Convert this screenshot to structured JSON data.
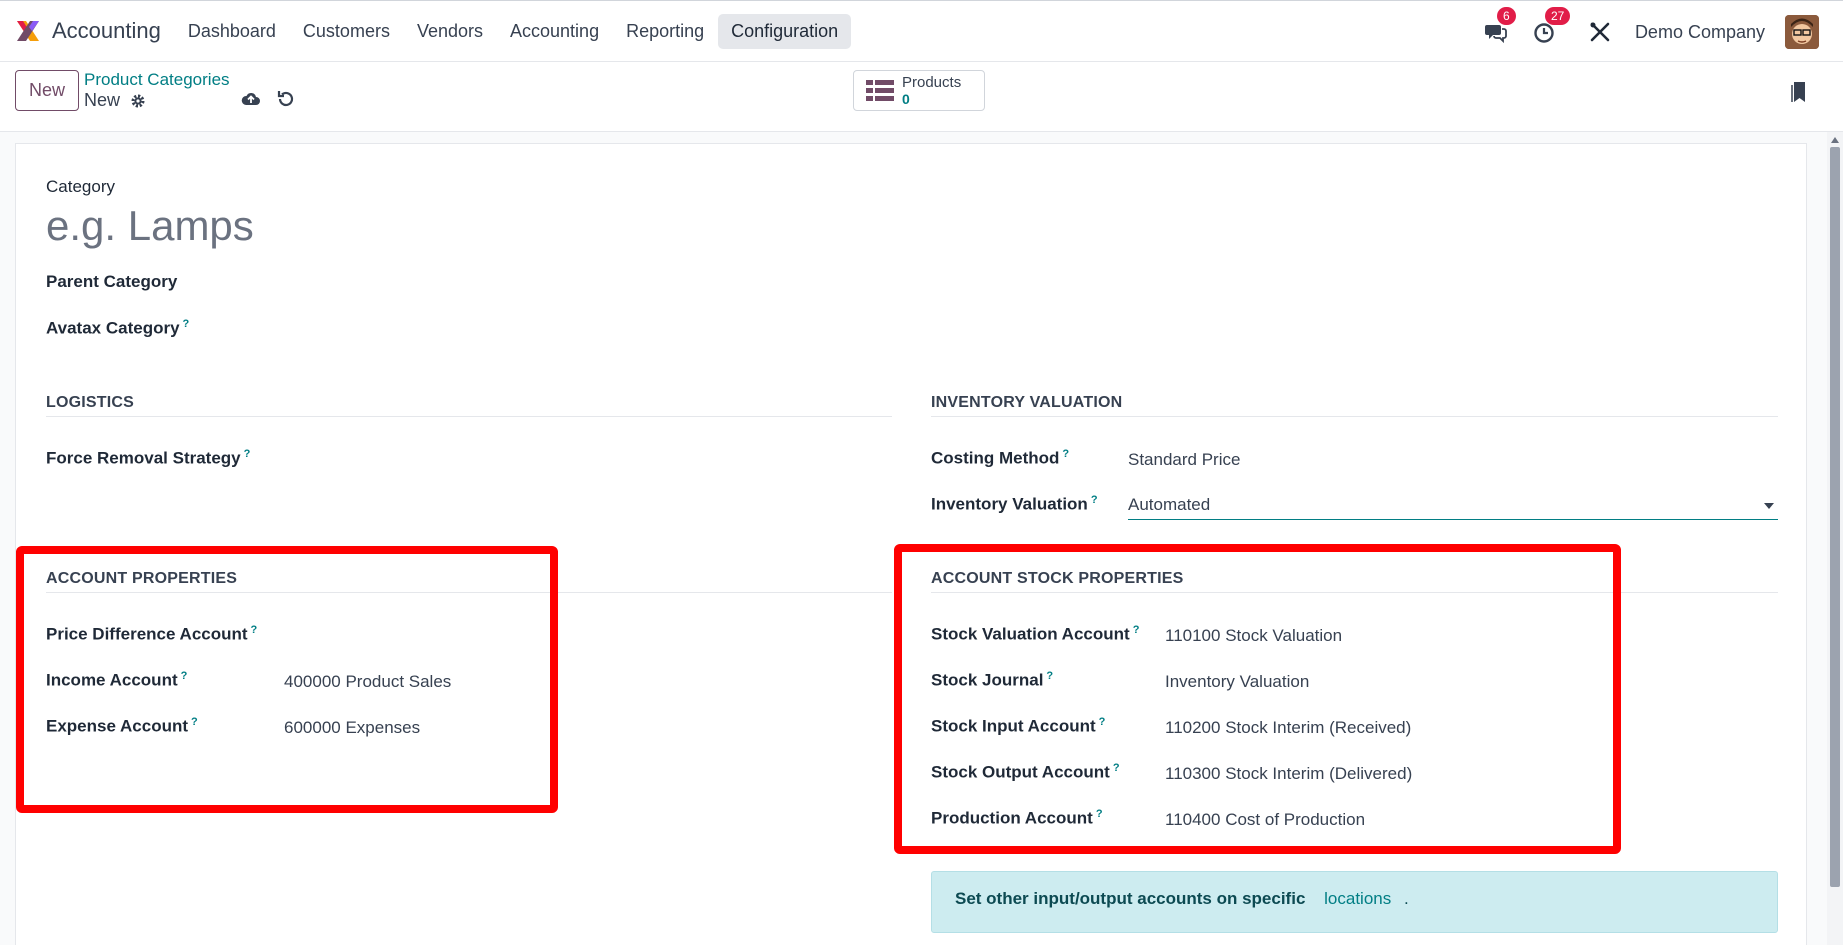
{
  "app": {
    "name": "Accounting"
  },
  "menu": {
    "items": [
      "Dashboard",
      "Customers",
      "Vendors",
      "Accounting",
      "Reporting",
      "Configuration"
    ],
    "active": "Configuration"
  },
  "systray": {
    "messages_count": "6",
    "activities_count": "27",
    "company": "Demo Company"
  },
  "control_panel": {
    "new_label": "New",
    "breadcrumb": "Product Categories",
    "record_name": "New",
    "smart_button": {
      "label": "Products",
      "count": "0"
    }
  },
  "form": {
    "category_label": "Category",
    "category_placeholder": "e.g. Lamps",
    "parent_category_label": "Parent Category",
    "avatax_category_label": "Avatax Category",
    "help_marker": "?",
    "logistics": {
      "title": "LOGISTICS",
      "force_removal_label": "Force Removal Strategy"
    },
    "inventory_valuation": {
      "title": "INVENTORY VALUATION",
      "costing_method_label": "Costing Method",
      "costing_method_value": "Standard Price",
      "inventory_valuation_label": "Inventory Valuation",
      "inventory_valuation_value": "Automated"
    },
    "account_properties": {
      "title": "ACCOUNT PROPERTIES",
      "price_difference_label": "Price Difference Account",
      "income_label": "Income Account",
      "income_value": "400000 Product Sales",
      "expense_label": "Expense Account",
      "expense_value": "600000 Expenses"
    },
    "account_stock_properties": {
      "title": "ACCOUNT STOCK PROPERTIES",
      "stock_valuation_label": "Stock Valuation Account",
      "stock_valuation_value": "110100 Stock Valuation",
      "stock_journal_label": "Stock Journal",
      "stock_journal_value": "Inventory Valuation",
      "stock_input_label": "Stock Input Account",
      "stock_input_value": "110200 Stock Interim (Received)",
      "stock_output_label": "Stock Output Account",
      "stock_output_value": "110300 Stock Interim (Delivered)",
      "production_label": "Production Account",
      "production_value": "110400 Cost of Production"
    },
    "alert": {
      "text": "Set other input/output accounts on specific",
      "link": "locations",
      "suffix": "."
    }
  },
  "colors": {
    "brand": "#714b67",
    "link": "#017e84",
    "highlight": "#ff0000",
    "badge": "#e11d48"
  }
}
